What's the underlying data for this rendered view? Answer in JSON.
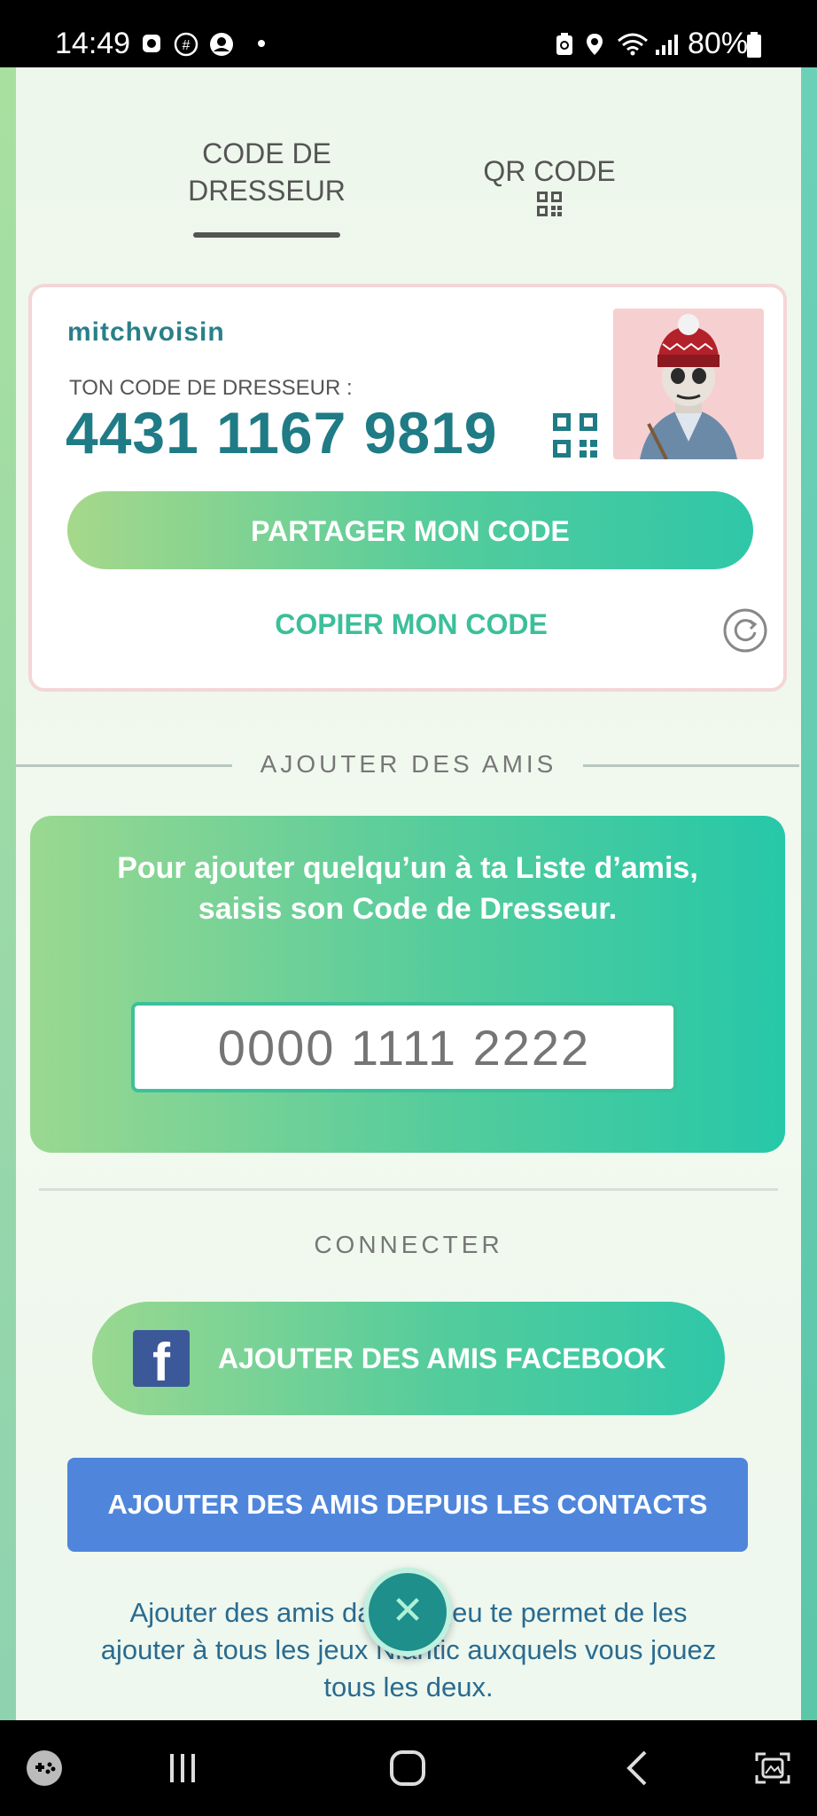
{
  "status_bar": {
    "time": "14:49",
    "battery": "80%",
    "icons": [
      "alarm-icon",
      "hashtag-icon",
      "account-icon",
      "dot-icon",
      "battery-saver-icon",
      "location-icon",
      "wifi-icon",
      "signal-icon",
      "battery-icon"
    ]
  },
  "tabs": {
    "trainer_code_line1": "CODE DE",
    "trainer_code_line2": "DRESSEUR",
    "qr_code": "QR CODE"
  },
  "profile_card": {
    "username": "mitchvoisin",
    "code_label": "TON CODE DE DRESSEUR :",
    "code_value": "4431 1167 9819",
    "share_button": "PARTAGER MON CODE",
    "copy_button": "COPIER MON CODE"
  },
  "add_friends": {
    "section_title": "AJOUTER DES AMIS",
    "instructions": "Pour ajouter quelqu’un à ta Liste d’amis, saisis son Code de Dresseur.",
    "input_placeholder": "0000 1111 2222"
  },
  "connect": {
    "section_title": "CONNECTER",
    "facebook_button": "AJOUTER DES AMIS FACEBOOK",
    "contacts_button": "AJOUTER DES AMIS DEPUIS LES CONTACTS",
    "info_text": "Ajouter des amis dans ce jeu te permet de les ajouter à tous les jeux Niantic auxquels vous jouez tous les deux."
  },
  "colors": {
    "accent_teal": "#1f7b85",
    "green_button": "#54cc9c",
    "contacts_blue": "#4f86dc",
    "facebook_blue": "#3b5998"
  }
}
